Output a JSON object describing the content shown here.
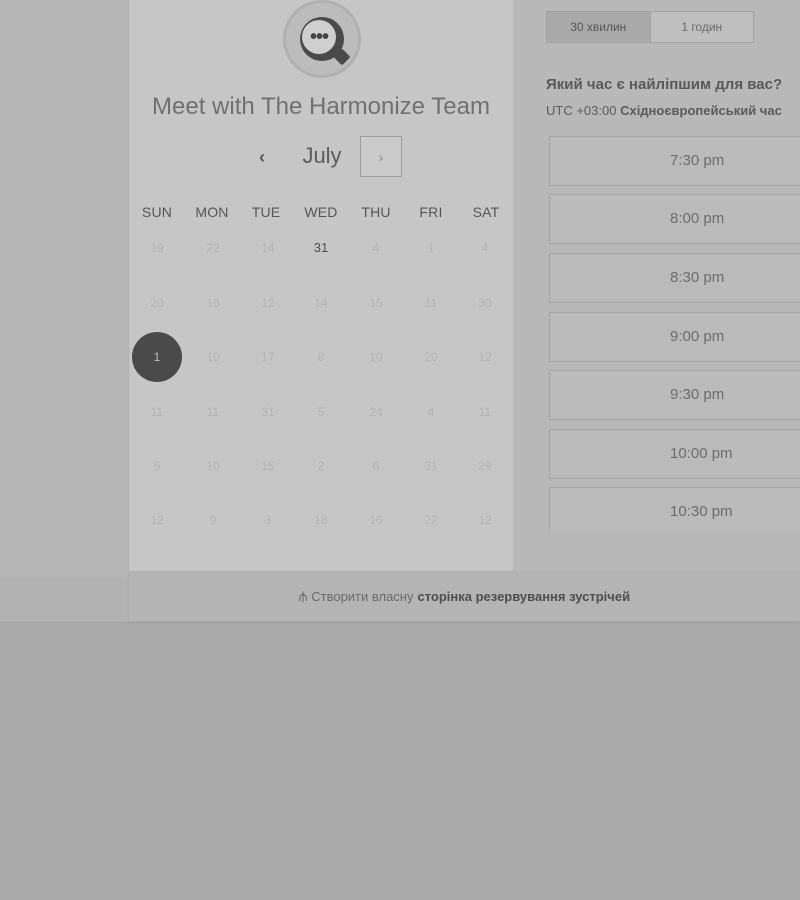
{
  "calendar": {
    "title": "Meet with The Harmonize Team",
    "month": "July",
    "prev_icon": "‹",
    "next_icon": "›",
    "avatar_icon": "•••",
    "weekdays": [
      "SUN",
      "MON",
      "TUE",
      "WED",
      "THU",
      "FRI",
      "SAT"
    ],
    "weeks": [
      [
        "19",
        "22",
        "14",
        "31",
        "4",
        "1",
        "4"
      ],
      [
        "20",
        "16",
        "12",
        "14",
        "15",
        "11",
        "30"
      ],
      [
        "1",
        "10",
        "17",
        "8",
        "10",
        "20",
        "12"
      ],
      [
        "11",
        "11",
        "31",
        "5",
        "24",
        "4",
        "11"
      ],
      [
        "5",
        "10",
        "15",
        "2",
        "6",
        "31",
        "29"
      ],
      [
        "12",
        "9",
        "3",
        "18",
        "16",
        "22",
        "12"
      ]
    ],
    "available_day": "31",
    "selected_day": "1"
  },
  "scheduler": {
    "durations": [
      "30 хвилин",
      "1 годин"
    ],
    "active_duration": "30 хвилин",
    "question": "Який час є найліпшим для вас?",
    "timezone_offset": "UTC +03:00",
    "timezone_name": "Східноєвропейський час",
    "slots": [
      "7:30 pm",
      "8:00 pm",
      "8:30 pm",
      "9:00 pm",
      "9:30 pm",
      "10:00 pm",
      "10:30 pm"
    ]
  },
  "footer": {
    "icon": "hubspot-sprocket-icon",
    "text": "Створити власну",
    "link": "сторінка резервування зустрічей"
  },
  "colors": {
    "selected_day_bg": "#4a4a4a",
    "overlay_gray": "#b5b5b5"
  }
}
